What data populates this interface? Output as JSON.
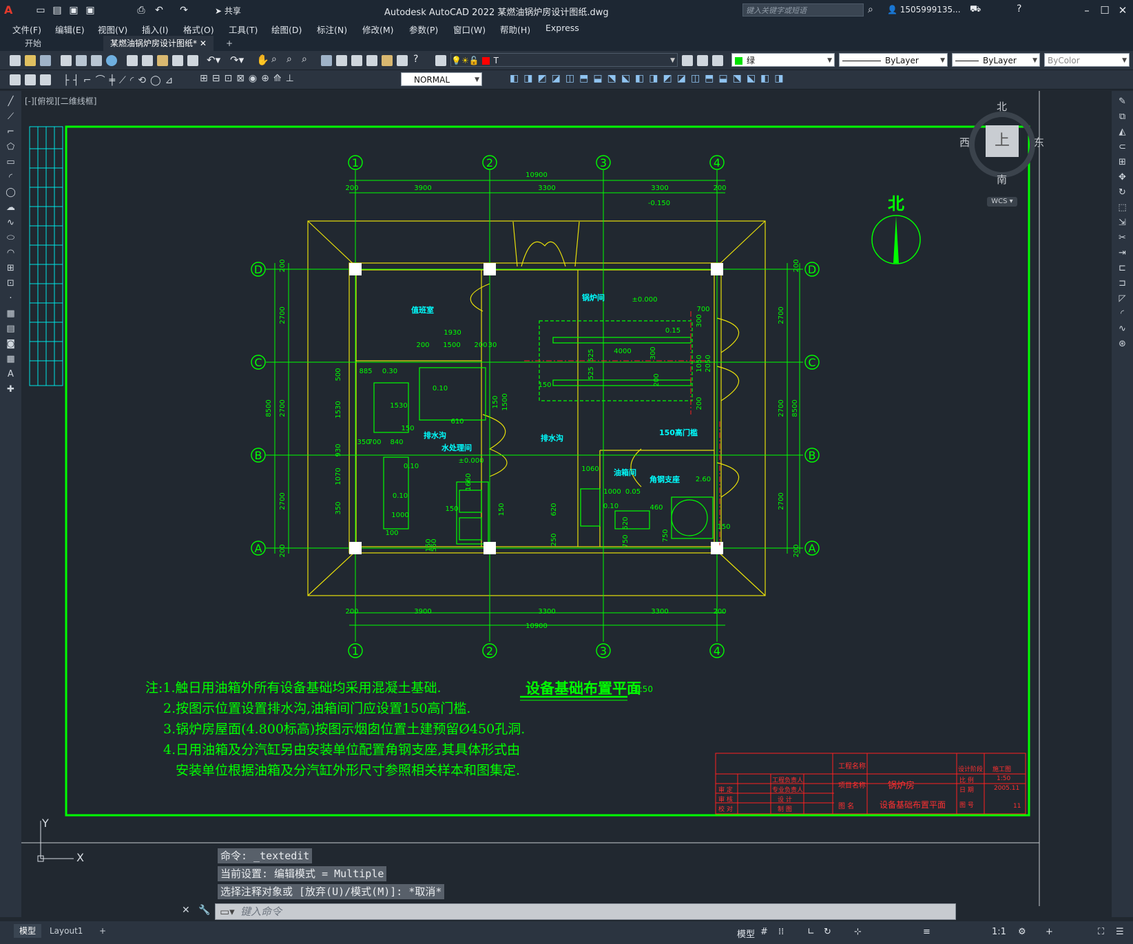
{
  "app": {
    "title": "Autodesk AutoCAD 2022    某燃油锅炉房设计图纸.dwg",
    "share_label": "共享"
  },
  "search": {
    "placeholder": "键入关键字或短语"
  },
  "user": {
    "name": "1505999135..."
  },
  "menu": {
    "items": [
      "文件(F)",
      "编辑(E)",
      "视图(V)",
      "插入(I)",
      "格式(O)",
      "工具(T)",
      "绘图(D)",
      "标注(N)",
      "修改(M)",
      "参数(P)",
      "窗口(W)",
      "帮助(H)",
      "Express"
    ]
  },
  "tabs": {
    "start": "开始",
    "document": "某燃油锅炉房设计图纸*",
    "add": "+"
  },
  "toolbar": {
    "layer_value": "T",
    "color_value": "绿",
    "linetype_value": "ByLayer",
    "lineweight_value": "ByLayer",
    "plotstyle_value": "ByColor",
    "dimstyle_value": "NORMAL"
  },
  "viewcube": {
    "north": "北",
    "south": "南",
    "east": "东",
    "west": "西",
    "top": "上",
    "wcs": "WCS"
  },
  "viewport": {
    "label": "[-][俯视][二维线框]"
  },
  "drawing": {
    "axes_top": [
      "1",
      "2",
      "3",
      "4"
    ],
    "axes_side": [
      "D",
      "C",
      "B",
      "A"
    ],
    "dims_top_total": "10900",
    "dims_top": [
      "200",
      "3900",
      "3300",
      "3300",
      "200"
    ],
    "level_roof": "-0.150",
    "dims_left": [
      "2700",
      "2700",
      "2700"
    ],
    "dims_left_total": "8500",
    "dims_end": "200",
    "rooms": {
      "duty": "值班室",
      "boiler": "锅炉间",
      "pump": "水处理间",
      "oil": "油箱间",
      "drain1": "排水沟",
      "drain2": "排水沟",
      "sill": "150高门槛",
      "angle": "角钢支座"
    },
    "labels": [
      "±0.000",
      "700",
      "1930",
      "200",
      "1500",
      "200",
      "30",
      "4000",
      "525",
      "525",
      "150",
      "0.15",
      "1050",
      "2050",
      "200",
      "300",
      "300",
      "200",
      "500",
      "885",
      "0.30",
      "0.10",
      "1530",
      "1530",
      "1500",
      "150",
      "150",
      "610",
      "930",
      "1070",
      "350",
      "350",
      "700",
      "840",
      "±0.000",
      "0.10",
      "0.10",
      "1000",
      "100",
      "1660",
      "150",
      "150",
      "550",
      "1060",
      "620",
      "250",
      "1000",
      "0.05",
      "0.10",
      "460",
      "520",
      "750",
      "750",
      "2.60",
      "150",
      "150"
    ],
    "notes": [
      "注:1.触日用油箱外所有设备基础均采用混凝土基础.",
      "2.按图示位置设置排水沟,油箱间门应设置150高门槛.",
      "3.锅炉房屋面(4.800标高)按图示烟囱位置土建预留Ø450孔洞.",
      "4.日用油箱及分汽缸另由安装单位配置角钢支座,其具体形式由",
      "安装单位根据油箱及分汽缸外形尺寸参照相关样本和图集定."
    ],
    "title": "设备基础布置平面",
    "scale": "1:50",
    "north_label": "北",
    "titleblock": {
      "project": "工程名称",
      "item": "项目名称",
      "proj_value": "锅炉房",
      "drawing": "图  名",
      "drawing_value": "设备基础布置平面",
      "stage": "设计阶段",
      "stage_value": "施工图",
      "ratio": "比  例",
      "ratio_value": "1:50",
      "date": "日  期",
      "date_value": "2005.11",
      "no": "图  号",
      "no_value": "11",
      "approve": "审  定",
      "check": "审  核",
      "proofread": "校  对",
      "leader": "工程负责人",
      "prof": "专业负责人",
      "design": "设  计",
      "draw": "制  图"
    }
  },
  "command": {
    "history": [
      "命令: _textedit",
      "当前设置: 编辑模式 = Multiple",
      "选择注释对象或 [放弃(U)/模式(M)]: *取消*"
    ],
    "placeholder": "键入命令"
  },
  "status": {
    "model_tab": "模型",
    "layout_tab": "Layout1",
    "model_btn": "模型",
    "scale": "1:1"
  },
  "ucs": {
    "x": "X",
    "y": "Y"
  },
  "colors": {
    "green": "#00ff00",
    "yellow": "#e8e00a",
    "cyan": "#00ffff",
    "red": "#ff2020",
    "bg": "#212830"
  }
}
